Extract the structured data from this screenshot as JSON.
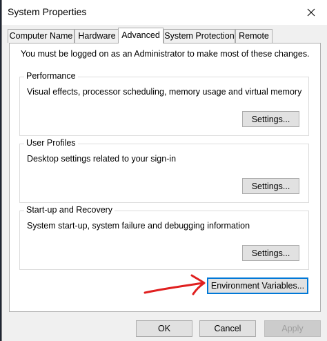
{
  "window": {
    "title": "System Properties"
  },
  "tabs": [
    {
      "label": "Computer Name",
      "active": false
    },
    {
      "label": "Hardware",
      "active": false
    },
    {
      "label": "Advanced",
      "active": true
    },
    {
      "label": "System Protection",
      "active": false
    },
    {
      "label": "Remote",
      "active": false
    }
  ],
  "advanced": {
    "notice": "You must be logged on as an Administrator to make most of these changes.",
    "performance": {
      "title": "Performance",
      "description": "Visual effects, processor scheduling, memory usage and virtual memory",
      "button_label": "Settings..."
    },
    "user_profiles": {
      "title": "User Profiles",
      "description": "Desktop settings related to your sign-in",
      "button_label": "Settings..."
    },
    "startup_recovery": {
      "title": "Start-up and Recovery",
      "description": "System start-up, system failure and debugging information",
      "button_label": "Settings..."
    },
    "env_button_label": "Environment Variables..."
  },
  "footer": {
    "ok_label": "OK",
    "cancel_label": "Cancel",
    "apply_label": "Apply"
  },
  "icons": {
    "close": "close-icon",
    "annotation": "red-arrow-annotation"
  },
  "colors": {
    "focus_border": "#0078d7",
    "annotation": "#e02020"
  }
}
